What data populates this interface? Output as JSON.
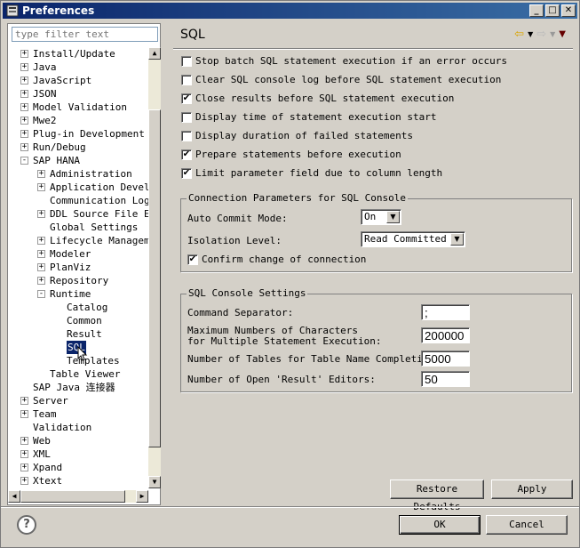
{
  "window": {
    "title": "Preferences",
    "minimize": "_",
    "maximize": "□",
    "close": "✕"
  },
  "filter": {
    "placeholder": "type filter text"
  },
  "tree": [
    {
      "label": "Install/Update",
      "level": 0,
      "exp": "+"
    },
    {
      "label": "Java",
      "level": 0,
      "exp": "+"
    },
    {
      "label": "JavaScript",
      "level": 0,
      "exp": "+"
    },
    {
      "label": "JSON",
      "level": 0,
      "exp": "+"
    },
    {
      "label": "Model Validation",
      "level": 0,
      "exp": "+"
    },
    {
      "label": "Mwe2",
      "level": 0,
      "exp": "+"
    },
    {
      "label": "Plug-in Development",
      "level": 0,
      "exp": "+"
    },
    {
      "label": "Run/Debug",
      "level": 0,
      "exp": "+"
    },
    {
      "label": "SAP HANA",
      "level": 0,
      "exp": "-"
    },
    {
      "label": "Administration",
      "level": 1,
      "exp": "+"
    },
    {
      "label": "Application Develo",
      "level": 1,
      "exp": "+"
    },
    {
      "label": "Communication Log",
      "level": 1,
      "exp": ""
    },
    {
      "label": "DDL Source File Ed",
      "level": 1,
      "exp": "+"
    },
    {
      "label": "Global Settings",
      "level": 1,
      "exp": ""
    },
    {
      "label": "Lifecycle Manageme",
      "level": 1,
      "exp": "+"
    },
    {
      "label": "Modeler",
      "level": 1,
      "exp": "+"
    },
    {
      "label": "PlanViz",
      "level": 1,
      "exp": "+"
    },
    {
      "label": "Repository",
      "level": 1,
      "exp": "+"
    },
    {
      "label": "Runtime",
      "level": 1,
      "exp": "-"
    },
    {
      "label": "Catalog",
      "level": 2,
      "exp": ""
    },
    {
      "label": "Common",
      "level": 2,
      "exp": ""
    },
    {
      "label": "Result",
      "level": 2,
      "exp": ""
    },
    {
      "label": "SQL",
      "level": 2,
      "exp": "",
      "selected": true
    },
    {
      "label": "Templates",
      "level": 2,
      "exp": ""
    },
    {
      "label": "Table Viewer",
      "level": 1,
      "exp": ""
    },
    {
      "label": "SAP Java 连接器",
      "level": 0,
      "exp": ""
    },
    {
      "label": "Server",
      "level": 0,
      "exp": "+"
    },
    {
      "label": "Team",
      "level": 0,
      "exp": "+"
    },
    {
      "label": "Validation",
      "level": 0,
      "exp": ""
    },
    {
      "label": "Web",
      "level": 0,
      "exp": "+"
    },
    {
      "label": "XML",
      "level": 0,
      "exp": "+"
    },
    {
      "label": "Xpand",
      "level": 0,
      "exp": "+"
    },
    {
      "label": "Xtext",
      "level": 0,
      "exp": "+"
    }
  ],
  "page": {
    "title": "SQL",
    "back_icon": "⇦",
    "forward_icon": "⇨",
    "menu_icon": "▼"
  },
  "options": [
    {
      "label": "Stop batch SQL statement execution if an error occurs",
      "checked": false
    },
    {
      "label": "Clear SQL console log before SQL statement execution",
      "checked": false
    },
    {
      "label": "Close results before SQL statement execution",
      "checked": true
    },
    {
      "label": "Display time of statement execution start",
      "checked": false
    },
    {
      "label": "Display duration of failed statements",
      "checked": false
    },
    {
      "label": "Prepare statements before execution",
      "checked": true
    },
    {
      "label": "Limit parameter field due to column length",
      "checked": true
    }
  ],
  "connection": {
    "legend": "Connection Parameters for SQL Console",
    "auto_commit_label": "Auto Commit Mode:",
    "auto_commit_value": "On",
    "isolation_label": "Isolation Level:",
    "isolation_value": "Read Committed",
    "confirm_label": "Confirm change of connection",
    "confirm_checked": true
  },
  "console": {
    "legend": "SQL Console Settings",
    "separator_label": "Command Separator:",
    "separator_value": ";",
    "maxchars_label_1": "Maximum Numbers of Characters",
    "maxchars_label_2": "for Multiple Statement Execution:",
    "maxchars_value": "200000",
    "tables_label": "Number of Tables for Table Name Completion:",
    "tables_value": "5000",
    "editors_label": "Number of Open 'Result' Editors:",
    "editors_value": "50"
  },
  "buttons": {
    "restore": "Restore Defaults",
    "apply": "Apply",
    "ok": "OK",
    "cancel": "Cancel",
    "help": "?"
  }
}
